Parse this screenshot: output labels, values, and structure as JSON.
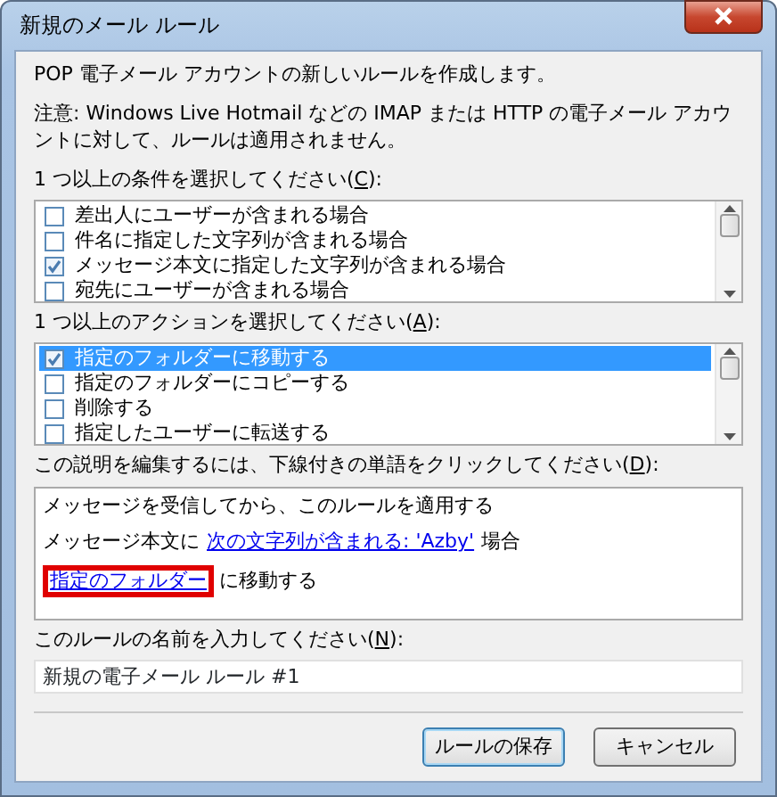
{
  "window": {
    "title": "新規のメール ルール"
  },
  "intro": "POP 電子メール アカウントの新しいルールを作成します。",
  "note": "注意: Windows Live Hotmail などの IMAP または HTTP の電子メール アカウントに対して、ルールは適用されません。",
  "conditions": {
    "label": {
      "before": "1 つ以上の条件を選択してください(",
      "accel": "C",
      "after": "):"
    },
    "items": [
      {
        "text": "差出人にユーザーが含まれる場合",
        "checked": false,
        "selected": false
      },
      {
        "text": "件名に指定した文字列が含まれる場合",
        "checked": false,
        "selected": false
      },
      {
        "text": "メッセージ本文に指定した文字列が含まれる場合",
        "checked": true,
        "selected": false
      },
      {
        "text": "宛先にユーザーが含まれる場合",
        "checked": false,
        "selected": false
      }
    ]
  },
  "actions": {
    "label": {
      "before": "1 つ以上のアクションを選択してください(",
      "accel": "A",
      "after": "):"
    },
    "items": [
      {
        "text": "指定のフォルダーに移動する",
        "checked": true,
        "selected": true
      },
      {
        "text": "指定のフォルダーにコピーする",
        "checked": false,
        "selected": false
      },
      {
        "text": "削除する",
        "checked": false,
        "selected": false
      },
      {
        "text": "指定したユーザーに転送する",
        "checked": false,
        "selected": false
      }
    ]
  },
  "description": {
    "label": {
      "before": "この説明を編集するには、下線付きの単語をクリックしてください(",
      "accel": "D",
      "after": "):"
    },
    "lines": [
      [
        {
          "kind": "text",
          "text": "メッセージを受信してから、このルールを適用する"
        }
      ],
      [
        {
          "kind": "text",
          "text": "メッセージ本文に"
        },
        {
          "kind": "link",
          "text": "次の文字列が含まれる: 'Azby'",
          "highlighted": false
        },
        {
          "kind": "text",
          "text": "場合"
        }
      ],
      [
        {
          "kind": "link",
          "text": "指定のフォルダー",
          "highlighted": true
        },
        {
          "kind": "text",
          "text": "に移動する"
        }
      ]
    ]
  },
  "rule_name": {
    "label": {
      "before": "このルールの名前を入力してください(",
      "accel": "N",
      "after": "):"
    },
    "value": "新規の電子メール ルール #1"
  },
  "buttons": [
    {
      "label": "ルールの保存",
      "default": true
    },
    {
      "label": "キャンセル",
      "default": false
    }
  ]
}
